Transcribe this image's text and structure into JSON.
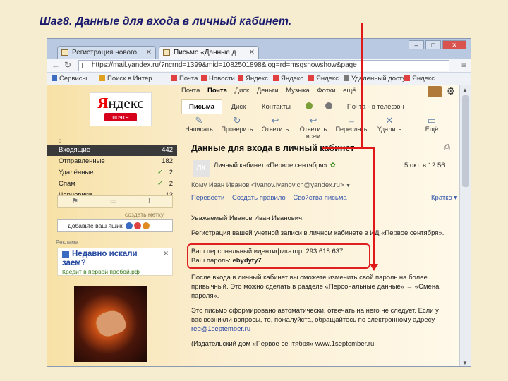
{
  "slide": {
    "title": "Шаг8. Данные для входа в личный кабинет."
  },
  "browser": {
    "tabs": [
      {
        "label": "Регистрация нового"
      },
      {
        "label": "Письмо «Данные д"
      }
    ],
    "url": "https://mail.yandex.ru/?ncrnd=1399&mid=1082501898&log=rd=msgshowshow&page",
    "bookmarks": [
      "Сервисы",
      "Поиск в Интер...",
      "Почта",
      "Новости",
      "Яндекс",
      "Яндекс",
      "Яндекс",
      "Удаленный доступ",
      "Яндекс"
    ]
  },
  "header": {
    "logo": "Яндекс",
    "logo_sub": "почта",
    "services": [
      "Почта",
      "Почта",
      "Диск",
      "Деньги",
      "Музыка",
      "Фотки",
      "ещё"
    ],
    "current_service_index": 1
  },
  "mailtabs": [
    "Письма",
    "Диск",
    "Контакты",
    "Почта - в телефон"
  ],
  "toolbar": [
    "Написать",
    "Проверить",
    "Ответить",
    "Ответить всем",
    "Переслать",
    "Удалить",
    "Ещё"
  ],
  "sidebar": {
    "new_folder": "о",
    "folders": [
      {
        "name": "Входящие",
        "count": "442",
        "checked": false
      },
      {
        "name": "Отправленные",
        "count": "182",
        "checked": false
      },
      {
        "name": "Удалённые",
        "count": "2",
        "checked": true
      },
      {
        "name": "Спам",
        "count": "2",
        "checked": true
      },
      {
        "name": "Черновики",
        "count": "13",
        "checked": false
      }
    ],
    "settings": "настроить",
    "create_label": "создать метку",
    "add_mailbox": "Добавьте ваш ящик",
    "ad_label": "Реклама",
    "ad_title_1": "Недавно искали",
    "ad_title_2": "заем?",
    "ad_link": "Кредит в первой пробой.рф"
  },
  "message": {
    "subject": "Данные для входа в личный кабинет",
    "avatar": "ЛК",
    "sender": "Личный кабинет «Первое сентября»",
    "date": "5 окт. в 12:56",
    "to": "Кому  Иван Иванов <ivanov.ivanovich@yandex.ru>",
    "actions": [
      "Перевести",
      "Создать правило",
      "Свойства письма"
    ],
    "brief": "Кратко",
    "greeting": "Уважаемый Иванов Иван Иванович.",
    "para1": "Регистрация вашей учетной записи в личном кабинете в ИД «Первое сентября».",
    "id_line": "Ваш персональный идентификатор: 293 618 637",
    "password_label": "Ваш пароль:",
    "password": "ebydyty7",
    "para2": "После входа в личный кабинет вы сможете изменить свой пароль на более привычный. Это можно сделать в разделе «Персональные данные» → «Смена пароля».",
    "para3": "Это письмо сформировано автоматически, отвечать на него не следует. Если у вас возникли вопросы, то, пожалуйста, обращайтесь по электронному адресу",
    "email": "reg@1september.ru",
    "footer": "(Издательский дом «Первое сентября» www.1september.ru"
  },
  "colors": {
    "highlight": "#e02020",
    "active_folder": "#3a3a3a",
    "brand_red": "#d6001c"
  }
}
